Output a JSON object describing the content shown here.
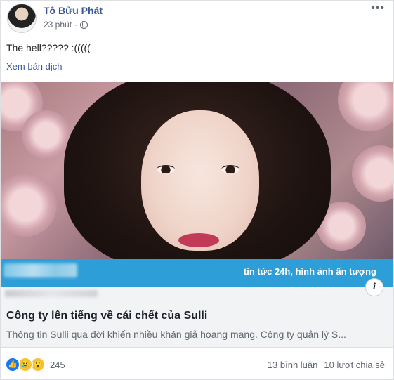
{
  "post": {
    "author": "Tô Bửu Phát",
    "time": "23 phút",
    "text": "The hell????? :(((((",
    "translate_link": "Xem bản dịch"
  },
  "link_preview": {
    "banner_text": "tin tức 24h, hình ảnh ấn tượng",
    "title": "Công ty lên tiếng về cái chết của Sulli",
    "description": "Thông tin Sulli qua đời khiến nhiều khán giả hoang mang. Công ty quản lý S...",
    "info_glyph": "i"
  },
  "footer": {
    "reaction_count": "245",
    "comments": "13 bình luận",
    "shares": "10 lượt chia sẻ"
  },
  "icons": {
    "reactions": [
      "like-icon",
      "sad-icon",
      "wow-icon"
    ],
    "privacy": "globe-icon",
    "menu": "more-icon"
  },
  "colors": {
    "link_blue": "#385898",
    "banner_blue": "#2d9ed8",
    "secondary_text": "#606770"
  }
}
